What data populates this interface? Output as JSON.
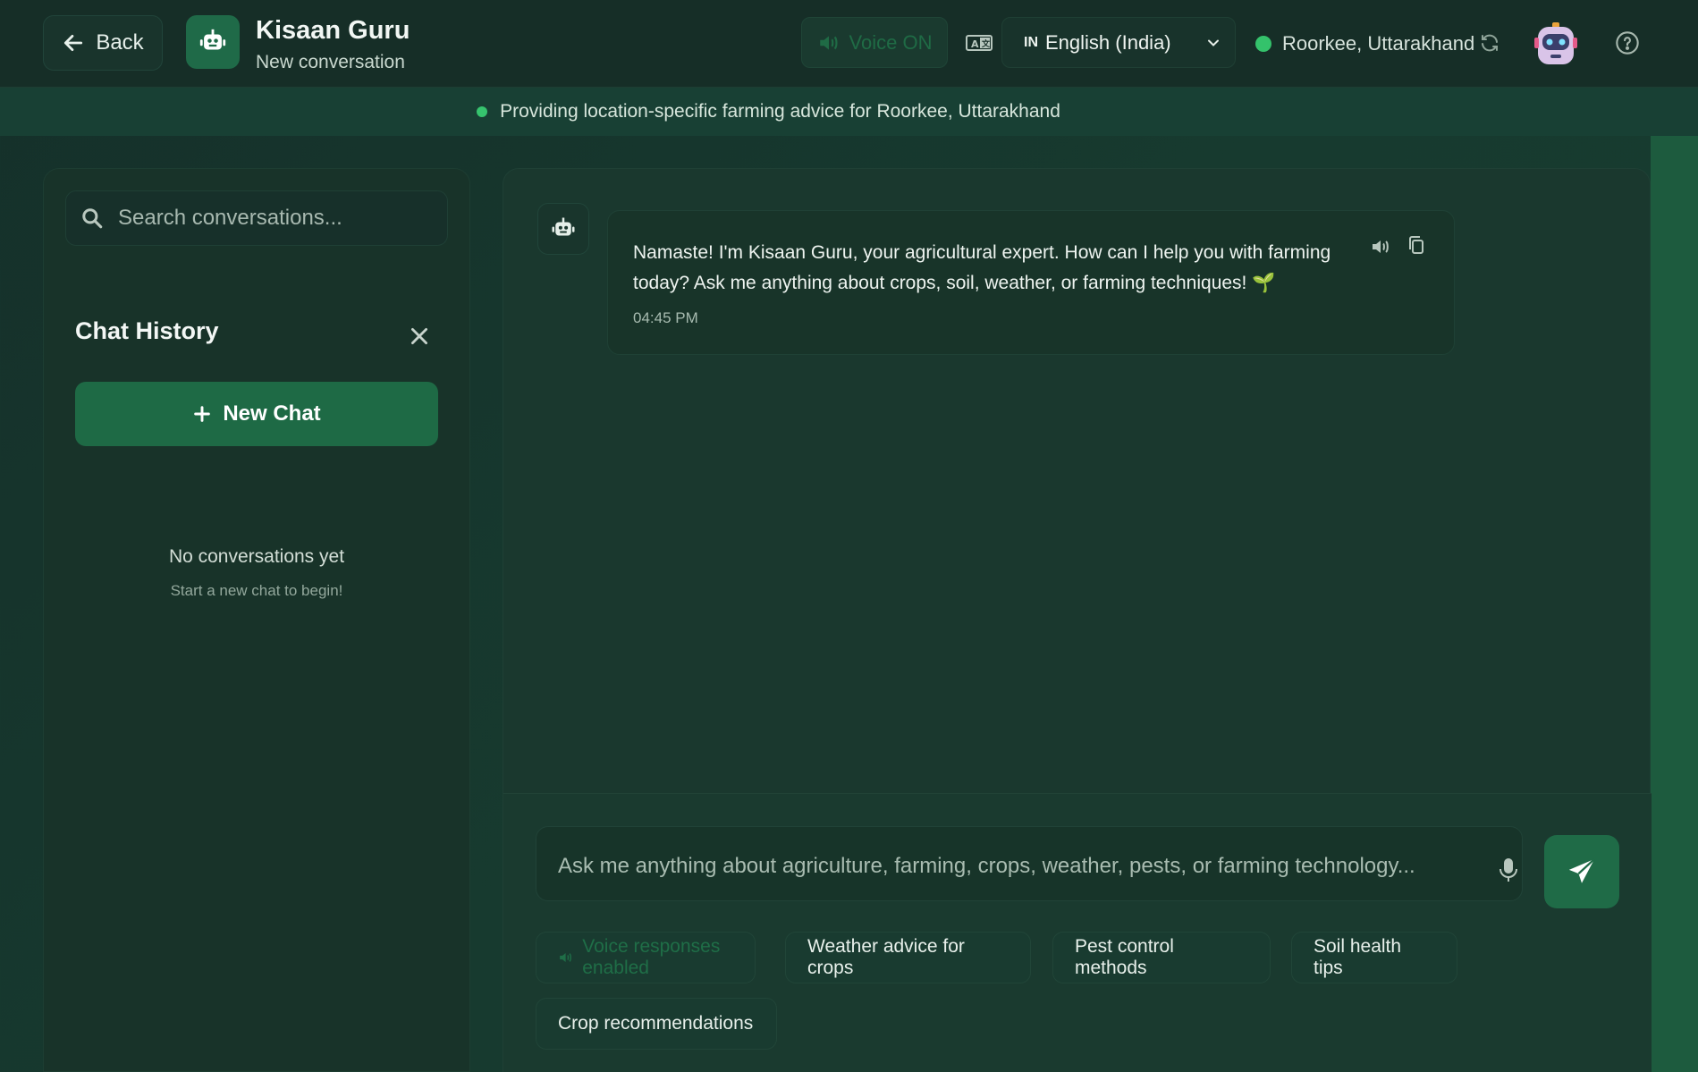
{
  "header": {
    "back_label": "Back",
    "app_title": "Kisaan Guru",
    "app_subtitle": "New conversation",
    "voice_label": "Voice ON",
    "language_flag": "IN",
    "language_label": "English (India)",
    "location": "Roorkee, Uttarakhand"
  },
  "banner": {
    "text": "Providing location-specific farming advice for Roorkee, Uttarakhand"
  },
  "sidebar": {
    "search_placeholder": "Search conversations...",
    "history_title": "Chat History",
    "new_chat_label": "New Chat",
    "empty_title": "No conversations yet",
    "empty_subtitle": "Start a new chat to begin!"
  },
  "chat": {
    "messages": [
      {
        "text": "Namaste! I'm Kisaan Guru, your agricultural expert. How can I help you with farming today? Ask me anything about crops, soil, weather, or farming techniques! 🌱",
        "time": "04:45 PM"
      }
    ],
    "input_placeholder": "Ask me anything about agriculture, farming, crops, weather, pests, or farming technology...",
    "chips": [
      "Voice responses enabled",
      "Weather advice for crops",
      "Pest control methods",
      "Soil health tips",
      "Crop recommendations"
    ]
  },
  "colors": {
    "accent": "#1e6a45",
    "status_green": "#34c26b",
    "background": "#173a2f"
  }
}
